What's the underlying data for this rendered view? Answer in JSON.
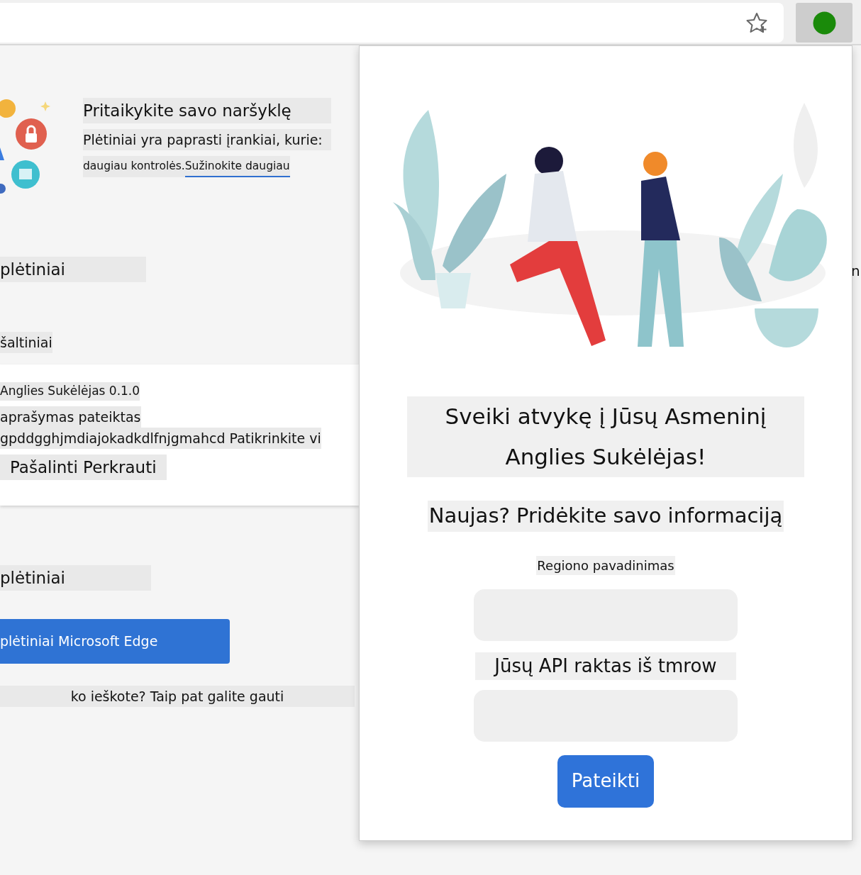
{
  "page": {
    "intro": {
      "heading": "Pritaikykite savo naršyklę",
      "description": "Plėtiniai yra paprasti įrankiai, kurie:",
      "text": "daugiau kontrolės.",
      "link": "Sužinokite daugiau"
    },
    "section_title": "plėtiniai",
    "sources_title": "šaltiniai",
    "extension_card": {
      "name_version": "Anglies Sukėlėjas 0.1.0",
      "description": "aprašymas pateiktas",
      "id_text": "gpddgghjmdiajokadkdlfnjgmahcd Patikrinkite vi",
      "actions": [
        "Pašalinti",
        "Perkrauti"
      ]
    },
    "section_title_2": "plėtiniai",
    "store_button": "plėtiniai Microsoft Edge",
    "footer_text": "ko ieškote? Taip pat galite gauti",
    "edge_fragment": "n"
  },
  "popup": {
    "title": "Sveiki atvykę į Jūsų Asmeninį Anglies Sukėlėjas!",
    "subtitle": "Naujas? Pridėkite savo informaciją",
    "fields": [
      {
        "label": "Regiono pavadinimas",
        "kind": "small"
      },
      {
        "label": "Jūsų API raktas iš tmrow",
        "kind": "large"
      }
    ],
    "submit_button": "Pateikti"
  }
}
